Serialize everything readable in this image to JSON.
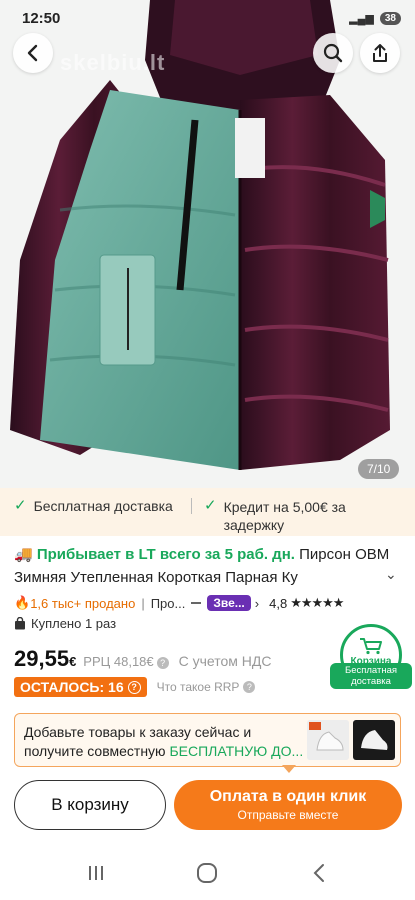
{
  "status": {
    "time": "12:50",
    "battery": "38"
  },
  "image": {
    "watermark": "skelbiu.lt",
    "counter": "7/10"
  },
  "shipping": {
    "free_label": "Бесплатная доставка",
    "credit_label": "Кредит на 5,00€ за задержку"
  },
  "product": {
    "arrive_text": "Прибывает в LT всего за 5 раб. дн.",
    "title": "Пирсон OBM Зимняя Утепленная Короткая Парная Ку",
    "sold": "1,6 тыс+ продано",
    "pro_label": "Про...",
    "star_badge": "Зве...",
    "rating": "4,8",
    "stars": "★★★★★",
    "bought": "Куплено 1 раз"
  },
  "price": {
    "value": "29,55",
    "currency": "€",
    "rrp": "РРЦ 48,18€",
    "vat": "С учетом НДС",
    "left_label": "ОСТАЛОСЬ: 16",
    "rrp_question": "Что такое RRP"
  },
  "cart_badge": {
    "label": "Корзина",
    "ribbon": "Бесплатная доставка"
  },
  "promo": {
    "text_start": "Добавьте товары к заказу сейчас и получите совместную ",
    "text_highlight": "БЕСПЛАТНУЮ ДО..."
  },
  "buttons": {
    "add_to_cart": "В корзину",
    "buy_now": "Оплата в один клик",
    "buy_now_sub": "Отправьте вместе"
  },
  "icons": {
    "back": "chevron-left-icon",
    "search": "search-icon",
    "share": "share-icon",
    "check": "check-icon",
    "truck": "truck-icon",
    "fire": "fire-icon",
    "bag": "bag-icon",
    "cart": "cart-icon"
  },
  "colors": {
    "accent_green": "#19a85b",
    "accent_orange": "#f57a1a",
    "badge_purple": "#6a2fb3"
  }
}
